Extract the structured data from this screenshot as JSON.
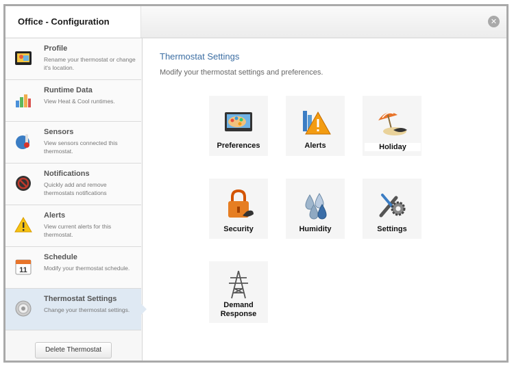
{
  "window": {
    "title": "Office - Configuration",
    "close_glyph": "✕"
  },
  "sidebar": {
    "items": [
      {
        "label": "Profile",
        "desc": "Rename your thermostat or change it's location.",
        "icon": "profile-photo-icon"
      },
      {
        "label": "Runtime Data",
        "desc": "View Heat & Cool runtimes.",
        "icon": "bar-chart-icon"
      },
      {
        "label": "Sensors",
        "desc": "View sensors connected this thermostat.",
        "icon": "thermometer-icon"
      },
      {
        "label": "Notifications",
        "desc": "Quickly add and remove thermostats notifications",
        "icon": "no-entry-icon"
      },
      {
        "label": "Alerts",
        "desc": "View current alerts for this thermostat.",
        "icon": "warning-icon"
      },
      {
        "label": "Schedule",
        "desc": "Modify your thermostat schedule.",
        "icon": "calendar-icon",
        "calendar_day": "11"
      },
      {
        "label": "Thermostat Settings",
        "desc": "Change your thermostat settings.",
        "icon": "thermostat-dial-icon"
      }
    ],
    "delete_button": "Delete Thermostat"
  },
  "main": {
    "title": "Thermostat Settings",
    "subtitle": "Modify your thermostat settings and preferences.",
    "tiles": [
      {
        "label": "Preferences",
        "icon": "palette-screen-icon"
      },
      {
        "label": "Alerts",
        "icon": "warning-chart-icon"
      },
      {
        "label": "Holiday",
        "icon": "beach-umbrella-icon"
      },
      {
        "label": "Security",
        "icon": "padlock-icon"
      },
      {
        "label": "Humidity",
        "icon": "water-drops-icon"
      },
      {
        "label": "Settings",
        "icon": "tools-gear-icon"
      },
      {
        "label_line1": "Demand",
        "label_line2": "Response",
        "icon": "power-tower-icon"
      }
    ]
  },
  "colors": {
    "accent": "#3c6ea3",
    "active_nav": "#dfe9f3",
    "alert": "#f39c12"
  }
}
